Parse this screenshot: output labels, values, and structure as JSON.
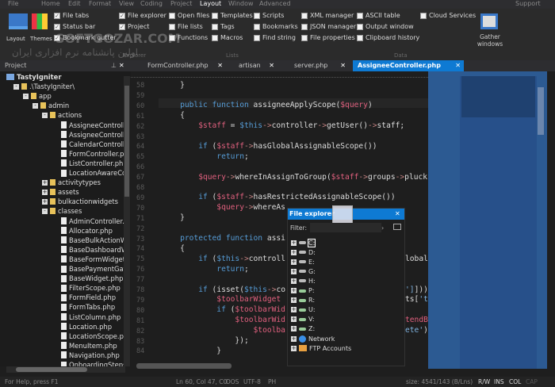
{
  "menu": {
    "items": [
      "File",
      "Home",
      "Edit",
      "Format",
      "View",
      "Coding",
      "Project",
      "Layout",
      "Window",
      "Advanced"
    ],
    "active": "Layout",
    "support": "Support"
  },
  "ribbon": {
    "layout_label": "Layout",
    "themes_label": "Themes",
    "checkboxes": [
      {
        "label": "File tabs",
        "checked": true
      },
      {
        "label": "Status bar",
        "checked": true
      },
      {
        "label": "Bookmark gutter",
        "checked": true
      },
      {
        "label": "File explorer",
        "checked": true
      },
      {
        "label": "Project",
        "checked": true
      },
      {
        "label": "Open files",
        "checked": false
      },
      {
        "label": "File lists",
        "checked": false
      },
      {
        "label": "Functions",
        "checked": false
      },
      {
        "label": "Templates",
        "checked": false
      },
      {
        "label": "Tags",
        "checked": false
      },
      {
        "label": "Macros",
        "checked": false
      },
      {
        "label": "Scripts",
        "checked": false
      },
      {
        "label": "Bookmarks",
        "checked": false
      },
      {
        "label": "Find string",
        "checked": false
      },
      {
        "label": "XML manager",
        "checked": false
      },
      {
        "label": "JSON manager",
        "checked": false
      },
      {
        "label": "File properties",
        "checked": false
      },
      {
        "label": "ASCII table",
        "checked": false
      },
      {
        "label": "Output window",
        "checked": false
      },
      {
        "label": "Clipboard history",
        "checked": false
      },
      {
        "label": "Cloud Services",
        "checked": false
      }
    ],
    "gather_label": "Gather windows",
    "groups": {
      "explorer": "Explorer",
      "lists": "Lists",
      "data": "Data"
    },
    "watermark": "SOFTGOZAR.COM",
    "watermark_sub": "اولین پانشنامه نرم افزاری ایران"
  },
  "project_panel": {
    "title": "Project"
  },
  "tabs": [
    {
      "label": "FormController.php",
      "active": false
    },
    {
      "label": "artisan",
      "active": false
    },
    {
      "label": "server.php",
      "active": false
    },
    {
      "label": "AssigneeController.php",
      "active": true
    }
  ],
  "tree": [
    {
      "label": "TastyIgniter",
      "depth": 0,
      "type": "project"
    },
    {
      "label": ".\\TastyIgniter\\",
      "depth": 1,
      "type": "folder",
      "exp": "-"
    },
    {
      "label": "app",
      "depth": 2,
      "type": "folder",
      "exp": "-"
    },
    {
      "label": "admin",
      "depth": 3,
      "type": "folder",
      "exp": "-"
    },
    {
      "label": "actions",
      "depth": 4,
      "type": "folder",
      "exp": "-"
    },
    {
      "label": "AssigneeControll",
      "depth": 5,
      "type": "file"
    },
    {
      "label": "AssigneeControll",
      "depth": 5,
      "type": "file"
    },
    {
      "label": "CalendarControll",
      "depth": 5,
      "type": "file"
    },
    {
      "label": "FormController.pl",
      "depth": 5,
      "type": "file"
    },
    {
      "label": "ListController.php",
      "depth": 5,
      "type": "file"
    },
    {
      "label": "LocationAwareCo",
      "depth": 5,
      "type": "file"
    },
    {
      "label": "activitytypes",
      "depth": 4,
      "type": "folder",
      "exp": "+"
    },
    {
      "label": "assets",
      "depth": 4,
      "type": "folder",
      "exp": "+"
    },
    {
      "label": "bulkactionwidgets",
      "depth": 4,
      "type": "folder",
      "exp": "+"
    },
    {
      "label": "classes",
      "depth": 4,
      "type": "folder",
      "exp": "-"
    },
    {
      "label": "AdminController.p",
      "depth": 5,
      "type": "file"
    },
    {
      "label": "Allocator.php",
      "depth": 5,
      "type": "file"
    },
    {
      "label": "BaseBulkActionW",
      "depth": 5,
      "type": "file"
    },
    {
      "label": "BaseDashboardW",
      "depth": 5,
      "type": "file"
    },
    {
      "label": "BaseFormWidget.",
      "depth": 5,
      "type": "file"
    },
    {
      "label": "BasePaymentGate",
      "depth": 5,
      "type": "file"
    },
    {
      "label": "BaseWidget.php",
      "depth": 5,
      "type": "file"
    },
    {
      "label": "FilterScope.php",
      "depth": 5,
      "type": "file"
    },
    {
      "label": "FormField.php",
      "depth": 5,
      "type": "file"
    },
    {
      "label": "FormTabs.php",
      "depth": 5,
      "type": "file"
    },
    {
      "label": "ListColumn.php",
      "depth": 5,
      "type": "file"
    },
    {
      "label": "Location.php",
      "depth": 5,
      "type": "file"
    },
    {
      "label": "LocationScope.ph",
      "depth": 5,
      "type": "file"
    },
    {
      "label": "MenuItem.php",
      "depth": 5,
      "type": "file"
    },
    {
      "label": "Navigation.php",
      "depth": 5,
      "type": "file"
    },
    {
      "label": "OnboardingSteps",
      "depth": 5,
      "type": "file"
    }
  ],
  "code": [
    {
      "n": "58",
      "t": [
        [
          "t",
          "    }"
        ]
      ]
    },
    {
      "n": "59",
      "t": []
    },
    {
      "n": "60",
      "t": [
        [
          "k",
          "    public function "
        ],
        [
          "t",
          "assigneeApplyScope("
        ],
        [
          "v",
          "$query"
        ],
        [
          "t",
          ")"
        ]
      ]
    },
    {
      "n": "61",
      "t": [
        [
          "t",
          "    {"
        ]
      ]
    },
    {
      "n": "62",
      "t": [
        [
          "v",
          "        $staff"
        ],
        [
          "t",
          " = "
        ],
        [
          "k",
          "$this"
        ],
        [
          "o",
          "->"
        ],
        [
          "t",
          "controller"
        ],
        [
          "o",
          "->"
        ],
        [
          "t",
          "getUser()"
        ],
        [
          "o",
          "->"
        ],
        [
          "t",
          "staff;"
        ]
      ]
    },
    {
      "n": "63",
      "t": []
    },
    {
      "n": "64",
      "t": [
        [
          "k",
          "        if "
        ],
        [
          "t",
          "("
        ],
        [
          "v",
          "$staff"
        ],
        [
          "o",
          "->"
        ],
        [
          "t",
          "hasGlobalAssignableScope())"
        ]
      ]
    },
    {
      "n": "65",
      "t": [
        [
          "k",
          "            return"
        ],
        [
          "t",
          ";"
        ]
      ]
    },
    {
      "n": "66",
      "t": []
    },
    {
      "n": "67",
      "t": [
        [
          "v",
          "        $query"
        ],
        [
          "o",
          "->"
        ],
        [
          "t",
          "whereInAssignToGroup("
        ],
        [
          "v",
          "$staff"
        ],
        [
          "o",
          "->"
        ],
        [
          "t",
          "groups"
        ],
        [
          "o",
          "->"
        ],
        [
          "t",
          "pluck("
        ],
        [
          "s",
          "'staf"
        ]
      ]
    },
    {
      "n": "68",
      "t": []
    },
    {
      "n": "69",
      "t": [
        [
          "k",
          "        if "
        ],
        [
          "t",
          "("
        ],
        [
          "v",
          "$staff"
        ],
        [
          "o",
          "->"
        ],
        [
          "t",
          "hasRestrictedAssignableScope())"
        ]
      ]
    },
    {
      "n": "70",
      "t": [
        [
          "v",
          "            $query"
        ],
        [
          "o",
          "->"
        ],
        [
          "t",
          "whereAs"
        ]
      ]
    },
    {
      "n": "71",
      "t": [
        [
          "t",
          "    }"
        ]
      ]
    },
    {
      "n": "72",
      "t": []
    },
    {
      "n": "73",
      "t": [
        [
          "k",
          "    protected function "
        ],
        [
          "t",
          "assi"
        ]
      ]
    },
    {
      "n": "74",
      "t": [
        [
          "t",
          "    {"
        ]
      ]
    },
    {
      "n": "75",
      "t": [
        [
          "k",
          "        if "
        ],
        [
          "t",
          "("
        ],
        [
          "k",
          "$this"
        ],
        [
          "o",
          "->"
        ],
        [
          "t",
          "controll"
        ]
      ],
      "r": [
        [
          "t",
          "lobalAssign"
        ]
      ]
    },
    {
      "n": "76",
      "t": [
        [
          "k",
          "            return"
        ],
        [
          "t",
          ";"
        ]
      ]
    },
    {
      "n": "77",
      "t": []
    },
    {
      "n": "78",
      "t": [
        [
          "k",
          "        if "
        ],
        [
          "t",
          "(isset("
        ],
        [
          "k",
          "$this"
        ],
        [
          "o",
          "->"
        ],
        [
          "t",
          "co"
        ]
      ],
      "r": [
        [
          "s",
          "']"
        ],
        [
          "t",
          "])) {"
        ]
      ]
    },
    {
      "n": "79",
      "t": [
        [
          "v",
          "            $toolbarWidget"
        ]
      ],
      "r": [
        [
          "t",
          "ts["
        ],
        [
          "s",
          "'toolbar"
        ]
      ]
    },
    {
      "n": "80",
      "t": [
        [
          "k",
          "            if "
        ],
        [
          "t",
          "("
        ],
        [
          "v",
          "$toolbarWid"
        ]
      ]
    },
    {
      "n": "81",
      "t": [
        [
          "v",
          "                $toolbarWid"
        ]
      ],
      "r": [
        [
          "v",
          "tendButtons"
        ]
      ]
    },
    {
      "n": "82",
      "t": [
        [
          "v",
          "                    $toolba"
        ]
      ],
      "r": [
        [
          "s",
          "ete'"
        ],
        [
          "t",
          ");"
        ]
      ]
    },
    {
      "n": "83",
      "t": [
        [
          "t",
          "                });"
        ]
      ]
    },
    {
      "n": "84",
      "t": [
        [
          "t",
          "            }"
        ]
      ]
    }
  ],
  "file_explorer": {
    "title": "File explorer",
    "filter_label": "Filter:",
    "filter_value": "",
    "items": [
      {
        "label": "C:",
        "type": "drive"
      },
      {
        "label": "D:",
        "type": "drive"
      },
      {
        "label": "E:",
        "type": "drive"
      },
      {
        "label": "G:",
        "type": "drive"
      },
      {
        "label": "H:",
        "type": "drive"
      },
      {
        "label": "P:",
        "type": "netdrive"
      },
      {
        "label": "R:",
        "type": "netdrive"
      },
      {
        "label": "U:",
        "type": "netdrive"
      },
      {
        "label": "V:",
        "type": "netdrive"
      },
      {
        "label": "Z:",
        "type": "netdrive"
      },
      {
        "label": "Network",
        "type": "network"
      },
      {
        "label": "FTP Accounts",
        "type": "ftp"
      }
    ]
  },
  "status": {
    "help": "For Help, press F1",
    "position": "Ln 60, Col 47, C0",
    "eol": "DOS",
    "encoding": "UTF-8",
    "lang": "PH",
    "size": "size: 4541/143 (B/Lns)",
    "rw": "R/W",
    "ins": "INS",
    "col": "COL",
    "cap": "CAP"
  },
  "colors": {
    "accent": "#0e7ad3",
    "minimap": "#2c5a92",
    "variable": "#e0607e",
    "keyword": "#569cd6"
  }
}
